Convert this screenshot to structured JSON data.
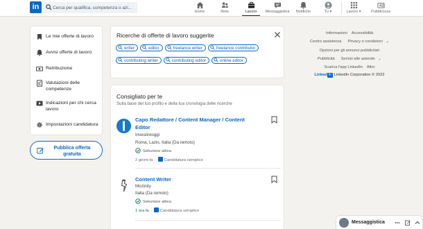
{
  "colors": {
    "brand": "#0a66c2",
    "background": "#f3f2ef",
    "active_green": "#057642"
  },
  "search": {
    "placeholder": "Cerca per qualifica, competenza o azi...",
    "icon": "search-icon"
  },
  "nav": {
    "items": [
      {
        "label": "Home",
        "icon": "home-icon"
      },
      {
        "label": "Rete",
        "icon": "network-icon"
      },
      {
        "label": "Lavoro",
        "icon": "briefcase-icon",
        "active": true
      },
      {
        "label": "Messaggistica",
        "icon": "messaging-icon"
      },
      {
        "label": "Notifiche",
        "icon": "bell-icon"
      },
      {
        "label": "Tu",
        "icon": "avatar"
      },
      {
        "label": "Lavoro",
        "icon": "grid-icon"
      },
      {
        "label": "Pubblicizza",
        "icon": "ads-icon"
      }
    ]
  },
  "sidebar": {
    "items": [
      {
        "label": "Le mie offerte di lavoro",
        "icon": "bookmark-icon"
      },
      {
        "label": "Avvisi offerte di lavoro",
        "icon": "bell-icon"
      },
      {
        "label": "Retribuzione",
        "icon": "money-icon"
      },
      {
        "label": "Valutazioni delle competenze",
        "icon": "checklist-icon"
      },
      {
        "label": "Indicazioni per chi cerca lavoro",
        "icon": "video-icon"
      },
      {
        "label": "Impostazioni candidatura",
        "icon": "gear-icon"
      }
    ],
    "post_button": "Pubblica offerta gratuita"
  },
  "suggested": {
    "title": "Ricerche di offerte di lavoro suggerite",
    "chips": [
      "writer",
      "editor",
      "freelance writer",
      "freelance contributor",
      "contributing writer",
      "contributing editor",
      "online editor"
    ]
  },
  "recommended": {
    "title": "Consigliato per te",
    "subtitle": "Sulla base del tuo profilo e della tua cronologia delle ricerche",
    "jobs": [
      {
        "title": "Capo Redattore / Content Manager / Content Editor",
        "company": "Investireoggi",
        "location": "Roma, Lazio, Italia (Da remoto)",
        "active_label": "Selezione attiva",
        "posted": "2 giorni fa",
        "sep": "·",
        "easy_apply": "Candidatura semplice",
        "posted_is_new": false
      },
      {
        "title": "Content Writer",
        "company": "Mozinity",
        "location": "Italia (Da remoto)",
        "active_label": "Selezione attiva",
        "posted": "1 ora fa",
        "sep": "·",
        "easy_apply": "Candidatura semplice",
        "posted_is_new": true
      }
    ]
  },
  "footer": {
    "links": [
      "Informazioni",
      "Accessibilità",
      "Centro assistenza",
      "Privacy e condizioni",
      "Opzioni per gli annunci pubblicitari",
      "Pubblicità",
      "Servizi alle aziende",
      "Scarica l'app LinkedIn",
      "Altro"
    ],
    "copyright_brand": "Linked",
    "copyright_box": "in",
    "copyright": "LinkedIn Corporation © 2022"
  },
  "messaging": {
    "title": "Messaggistica"
  }
}
